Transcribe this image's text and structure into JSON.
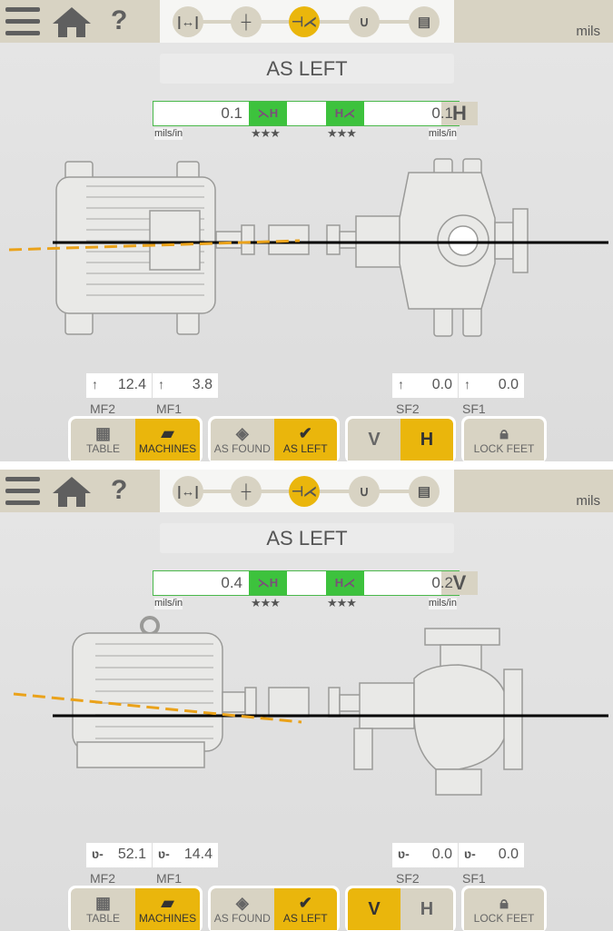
{
  "panels": [
    {
      "header": {
        "units": "mils",
        "help": "?"
      },
      "title": "AS LEFT",
      "readout": {
        "left_value": "0.1",
        "right_value": "0.1",
        "axis": "H",
        "left_unit": "mils/in",
        "right_unit": "mils/in",
        "left_stars": "★★★",
        "right_stars": "★★★",
        "left_icon": "angle-icon",
        "right_icon": "offset-icon"
      },
      "view": "top",
      "feet": [
        {
          "label": "MF2",
          "value": "12.4",
          "arrow": "↑"
        },
        {
          "label": "MF1",
          "value": "3.8",
          "arrow": "↑"
        },
        {
          "label": "SF2",
          "value": "0.0",
          "arrow": "↑"
        },
        {
          "label": "SF1",
          "value": "0.0",
          "arrow": "↑"
        }
      ],
      "buttons": {
        "table": "TABLE",
        "machines": "MACHINES",
        "as_found": "AS FOUND",
        "as_left": "AS LEFT",
        "v": "V",
        "h": "H",
        "lock_feet": "LOCK FEET"
      },
      "active_axis": "H"
    },
    {
      "header": {
        "units": "mils",
        "help": "?"
      },
      "title": "AS LEFT",
      "readout": {
        "left_value": "0.4",
        "right_value": "0.2",
        "axis": "V",
        "left_unit": "mils/in",
        "right_unit": "mils/in",
        "left_stars": "★★★",
        "right_stars": "★★★",
        "left_icon": "angle-icon",
        "right_icon": "offset-icon"
      },
      "view": "side",
      "feet": [
        {
          "label": "MF2",
          "value": "52.1",
          "arrow": "ʋ-"
        },
        {
          "label": "MF1",
          "value": "14.4",
          "arrow": "ʋ-"
        },
        {
          "label": "SF2",
          "value": "0.0",
          "arrow": "ʋ-"
        },
        {
          "label": "SF1",
          "value": "0.0",
          "arrow": "ʋ-"
        }
      ],
      "buttons": {
        "table": "TABLE",
        "machines": "MACHINES",
        "as_found": "AS FOUND",
        "as_left": "AS LEFT",
        "v": "V",
        "h": "H",
        "lock_feet": "LOCK FEET"
      },
      "active_axis": "V"
    }
  ],
  "colors": {
    "accent": "#eab60c",
    "good": "#3dc23d",
    "header": "#d8d3c3",
    "misalign_line": "#eaa21a"
  }
}
